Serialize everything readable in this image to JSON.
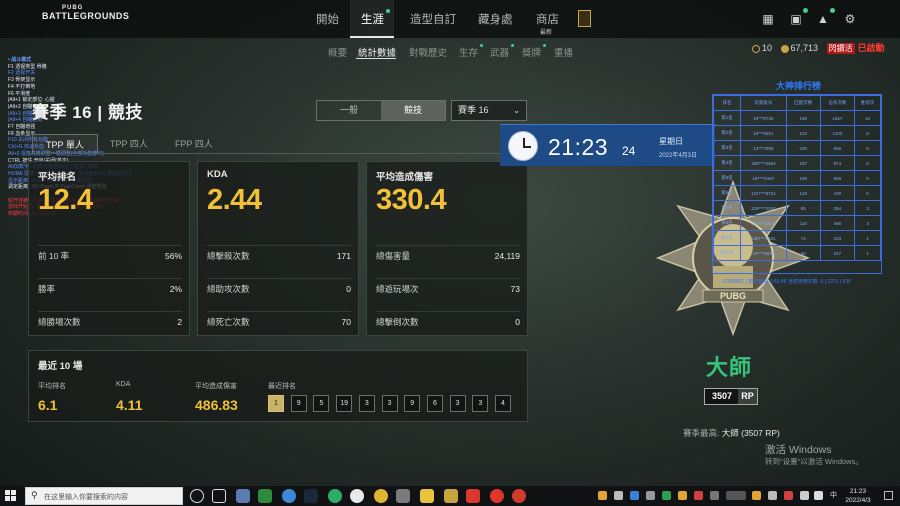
{
  "logo": {
    "small": "PUBG",
    "big": "BATTLEGROUNDS"
  },
  "nav": {
    "tabs": [
      "開始",
      "生涯",
      "造型自訂",
      "藏身處",
      "商店"
    ],
    "new_label": "最新"
  },
  "subnav": {
    "tabs": [
      "概要",
      "統計數據",
      "對戰歷史",
      "生存",
      "武器",
      "獎牌",
      "重播"
    ]
  },
  "currency": {
    "bp": "10",
    "gcoin": "67,713",
    "event_badge": "閃鑽活",
    "event_status": "已啟動"
  },
  "overlay_left": {
    "title": "• 战斗模式",
    "lines": [
      {
        "t": "F1 透视类型     骨骼",
        "c": ""
      },
      {
        "t": "F2 透视开关",
        "c": "blue"
      },
      {
        "t": "F3 骨架显示",
        "c": ""
      },
      {
        "t": "F4 不打倒地",
        "c": ""
      },
      {
        "t": "F6 平滑度",
        "c": ""
      },
      {
        "t": "  |Alt+1 锁定部位: 心脏",
        "c": ""
      },
      {
        "t": "  |Alt+2 自瞄合併",
        "c": ""
      },
      {
        "t": "  |Alt+3 自瞄力道",
        "c": "blue"
      },
      {
        "t": "  |Alt+4 自瞄距离",
        "c": "blue"
      },
      {
        "t": "F7 自瞄增强",
        "c": ""
      },
      {
        "t": "F8 血条显示",
        "c": ""
      },
      {
        "t": "F10 关闭所有功能",
        "c": "blue"
      },
      {
        "t": "Ctrl+G 快速补血",
        "c": "blue"
      },
      {
        "t": "Alt+5 视角高度调整一键调整(全部功能都可)",
        "c": "blue"
      },
      {
        "t": "CTRL 按住 开启/关闭(单次)",
        "c": ""
      },
      {
        "t": "Alt加数字3 隐藏功能面板/显示面板, 加速!",
        "c": "blue"
      },
      {
        "t": "HOME 隐藏/显示菜单, F9 加速, 关闭面板Del 删除自定义",
        "c": "blue"
      },
      {
        "t": "显示距离: 1000 / 自瞄: 300 / 骨骼显示",
        "c": "blue"
      },
      {
        "t": "调定距离: 150 PageUP PageDown 调整范围",
        "c": ""
      },
      {
        "t": "",
        "c": ""
      },
      {
        "t": "偷开挂被封号禁止, 将封禁封杀一天, 本辅助不管你!",
        "c": "red"
      },
      {
        "t": "游戏开始前, 请先关掉其他加速器大声说话!",
        "c": "red"
      },
      {
        "t": "到期时间: 2022-04-04",
        "c": "red"
      }
    ]
  },
  "season": {
    "title": "賽季 16 | 競技",
    "modes": [
      "一般",
      "競技"
    ],
    "selected_season": "賽季 16"
  },
  "perspective_tabs": [
    "TPP 單人",
    "TPP 四人",
    "FPP 四人"
  ],
  "cards": [
    {
      "title": "平均排名",
      "value": "12.4",
      "rows": [
        {
          "label": "前 10 率",
          "value": "56%"
        },
        {
          "label": "勝率",
          "value": "2%"
        },
        {
          "label": "總勝場次數",
          "value": "2"
        }
      ]
    },
    {
      "title": "KDA",
      "value": "2.44",
      "rows": [
        {
          "label": "總擊殺次數",
          "value": "171"
        },
        {
          "label": "總助攻次數",
          "value": "0"
        },
        {
          "label": "總死亡次數",
          "value": "70"
        }
      ]
    },
    {
      "title": "平均造成傷害",
      "value": "330.4",
      "rows": [
        {
          "label": "總傷害量",
          "value": "24,119"
        },
        {
          "label": "總遊玩場次",
          "value": "73"
        },
        {
          "label": "總擊倒次數",
          "value": "0"
        }
      ]
    }
  ],
  "recent": {
    "title": "最近 10 場",
    "avg_rank_label": "平均排名",
    "avg_rank": "6.1",
    "kda_label": "KDA",
    "kda": "4.11",
    "dmg_label": "平均造成傷害",
    "dmg": "486.83",
    "ranks_label": "最近排名",
    "ranks": [
      "1",
      "9",
      "5",
      "19",
      "3",
      "3",
      "9",
      "6",
      "3",
      "3",
      "4"
    ]
  },
  "clock": {
    "time": "21:23",
    "seconds": "24",
    "weekday": "星期日",
    "date": "2022年4月3日"
  },
  "ranking": {
    "title": "大神排行榜",
    "headers": [
      "排名",
      "玩家账号",
      "匹配次数",
      "击杀次数",
      "胜场次"
    ],
    "rows": [
      [
        "第1名",
        "19***5730",
        "185",
        "1657",
        "10"
      ],
      [
        "第2名",
        "19***5921",
        "122",
        "1103",
        "8"
      ],
      [
        "第3名",
        "13***7896",
        "430",
        "656",
        "6"
      ],
      [
        "第4名",
        "189****2664",
        "197",
        "874",
        "5"
      ],
      [
        "第5名",
        "18****8167",
        "196",
        "659",
        "5"
      ],
      [
        "第6名",
        "131****8724",
        "120",
        "430",
        "5"
      ],
      [
        "第7名",
        "139****2047",
        "85",
        "394",
        "3"
      ],
      [
        "第8名",
        "15****5217",
        "110",
        "466",
        "3"
      ],
      [
        "第9名",
        "138****0331",
        "74",
        "233",
        "1"
      ],
      [
        "第10名",
        "19****6653",
        "98",
        "247",
        "1"
      ]
    ],
    "footer": "12345667 | 您已登录 3:53:46 当前使用次数: 6 | 2221 | 636"
  },
  "tier": {
    "name": "大師",
    "rp": "3507",
    "rp_unit": "RP"
  },
  "season_high": {
    "label": "賽季最高:",
    "value": "大師 (3507 RP)"
  },
  "windows": {
    "activate": "激活 Windows",
    "hint": "转到\"设置\"以激活 Windows。"
  },
  "taskbar": {
    "search_placeholder": "在这里输入你要搜索的内容",
    "lang": "中",
    "time": "21:23",
    "date": "2022/4/3"
  },
  "colors": {
    "accent_gold": "#f2c139",
    "tier_green": "#35c47a",
    "new_dot": "#3fd28a"
  }
}
